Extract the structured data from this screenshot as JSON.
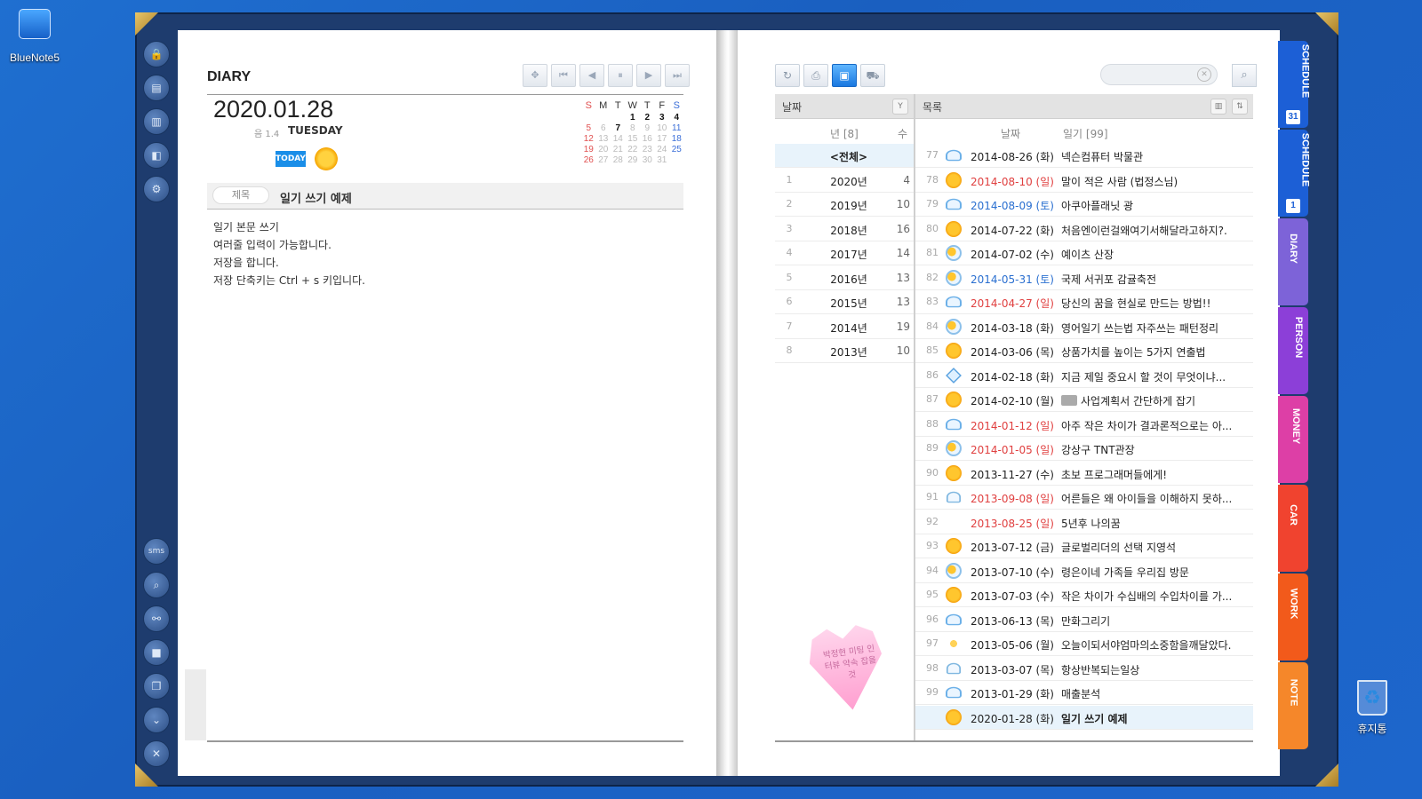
{
  "desktop": {
    "app_icon_label": "BlueNote5",
    "recycle_label": "휴지통"
  },
  "left_page": {
    "section_title": "DIARY",
    "date": "2020.01.28",
    "lunar": "음 1.4",
    "weekday": "TUESDAY",
    "today_label": "TODAY",
    "calendar": {
      "weekdays": [
        "S",
        "M",
        "T",
        "W",
        "T",
        "F",
        "S"
      ],
      "weeks": [
        [
          "",
          "",
          "",
          "1",
          "2",
          "3",
          "4"
        ],
        [
          "5",
          "6",
          "7",
          "8",
          "9",
          "10",
          "11"
        ],
        [
          "12",
          "13",
          "14",
          "15",
          "16",
          "17",
          "18"
        ],
        [
          "19",
          "20",
          "21",
          "22",
          "23",
          "24",
          "25"
        ],
        [
          "26",
          "27",
          "28",
          "29",
          "30",
          "31",
          ""
        ]
      ]
    },
    "subject_label": "제목",
    "subject_value": "일기 쓰기 예제",
    "body_lines": [
      "일기 본문 쓰기",
      "여러줄 입력이 가능합니다.",
      "저장을 합니다.",
      "저장 단축키는 Ctrl + s 키입니다."
    ]
  },
  "right_page": {
    "year_header": "날짜",
    "list_header": "목록",
    "year_col_label": "년 [8]",
    "count_col_label": "수",
    "date_col_label": "날짜",
    "diary_col_label": "일기 [99]",
    "search_value": "",
    "years": [
      {
        "n": "",
        "year": "<전체>",
        "count": ""
      },
      {
        "n": "1",
        "year": "2020년",
        "count": "4"
      },
      {
        "n": "2",
        "year": "2019년",
        "count": "10"
      },
      {
        "n": "3",
        "year": "2018년",
        "count": "16"
      },
      {
        "n": "4",
        "year": "2017년",
        "count": "14"
      },
      {
        "n": "5",
        "year": "2016년",
        "count": "13"
      },
      {
        "n": "6",
        "year": "2015년",
        "count": "13"
      },
      {
        "n": "7",
        "year": "2014년",
        "count": "19"
      },
      {
        "n": "8",
        "year": "2013년",
        "count": "10"
      }
    ],
    "entries": [
      {
        "n": "77",
        "weather": "cloud",
        "date": "2014-08-26 (화)",
        "color": "",
        "title": "넥슨컴퓨터 박물관"
      },
      {
        "n": "78",
        "weather": "sun",
        "date": "2014-08-10 (일)",
        "color": "red",
        "title": "말이 적은 사람 (법정스님)"
      },
      {
        "n": "79",
        "weather": "cloud",
        "date": "2014-08-09 (토)",
        "color": "blue",
        "title": "아쿠아플래닛 광"
      },
      {
        "n": "80",
        "weather": "sun",
        "date": "2014-07-22 (화)",
        "color": "",
        "title": "처음엔이런걸왜여기서해달라고하지?."
      },
      {
        "n": "81",
        "weather": "part",
        "date": "2014-07-02 (수)",
        "color": "",
        "title": "예이츠 산장"
      },
      {
        "n": "82",
        "weather": "part",
        "date": "2014-05-31 (토)",
        "color": "blue",
        "title": "국제 서귀포 감귤축전"
      },
      {
        "n": "83",
        "weather": "cloud",
        "date": "2014-04-27 (일)",
        "color": "red",
        "title": "당신의 꿈을 현실로 만드는 방법!!"
      },
      {
        "n": "84",
        "weather": "part",
        "date": "2014-03-18 (화)",
        "color": "",
        "title": "영어일기 쓰는법 자주쓰는 패턴정리"
      },
      {
        "n": "85",
        "weather": "sun",
        "date": "2014-03-06 (목)",
        "color": "",
        "title": "상품가치를 높이는 5가지 연출법"
      },
      {
        "n": "86",
        "weather": "diamond",
        "date": "2014-02-18 (화)",
        "color": "",
        "title": "지금 제일 중요시 할 것이 무엇이냐..."
      },
      {
        "n": "87",
        "weather": "sun",
        "date": "2014-02-10 (월)",
        "color": "",
        "title": "사업계획서 간단하게 잡기",
        "camera": true
      },
      {
        "n": "88",
        "weather": "cloud",
        "date": "2014-01-12 (일)",
        "color": "red",
        "title": "아주 작은 차이가 결과론적으로는 아..."
      },
      {
        "n": "89",
        "weather": "part",
        "date": "2014-01-05 (일)",
        "color": "red",
        "title": "강상구 TNT관장"
      },
      {
        "n": "90",
        "weather": "sun",
        "date": "2013-11-27 (수)",
        "color": "",
        "title": "초보 프로그래머들에게!"
      },
      {
        "n": "91",
        "weather": "rain",
        "date": "2013-09-08 (일)",
        "color": "red",
        "title": "어른들은 왜 아이들을 이해하지 못하..."
      },
      {
        "n": "92",
        "weather": "none",
        "date": "2013-08-25 (일)",
        "color": "red",
        "title": "5년후 나의꿈"
      },
      {
        "n": "93",
        "weather": "sun",
        "date": "2013-07-12 (금)",
        "color": "",
        "title": "글로벌리더의 선택 지영석"
      },
      {
        "n": "94",
        "weather": "part",
        "date": "2013-07-10 (수)",
        "color": "",
        "title": "령은이네 가족들 우리집 방문"
      },
      {
        "n": "95",
        "weather": "sun",
        "date": "2013-07-03 (수)",
        "color": "",
        "title": "작은 차이가 수십배의 수입차이를 가..."
      },
      {
        "n": "96",
        "weather": "cloud",
        "date": "2013-06-13 (목)",
        "color": "",
        "title": "만화그리기"
      },
      {
        "n": "97",
        "weather": "sunman",
        "date": "2013-05-06 (월)",
        "color": "",
        "title": "오늘이되서야엄마의소중함을깨달았다."
      },
      {
        "n": "98",
        "weather": "rain",
        "date": "2013-03-07 (목)",
        "color": "",
        "title": "항상반복되는일상"
      },
      {
        "n": "99",
        "weather": "cloud",
        "date": "2013-01-29 (화)",
        "color": "",
        "title": "매출분석"
      },
      {
        "n": "",
        "weather": "sun",
        "date": "2020-01-28 (화)",
        "color": "",
        "title": "일기 쓰기 예제",
        "selected": true
      }
    ],
    "sticky_note": "박정현 미팅 인터뷰 약속 잡을것"
  },
  "tabs": [
    {
      "label": "SCHEDULE",
      "badge": "31",
      "color": "#1c5fd6"
    },
    {
      "label": "SCHEDULE",
      "badge": "1",
      "color": "#1c5fd6"
    },
    {
      "label": "DIARY",
      "badge": "",
      "color": "#7d63d8"
    },
    {
      "label": "PERSON",
      "badge": "",
      "color": "#8c3fd8"
    },
    {
      "label": "MONEY",
      "badge": "",
      "color": "#dd3fa6"
    },
    {
      "label": "CAR",
      "badge": "",
      "color": "#f0432f"
    },
    {
      "label": "WORK",
      "badge": "",
      "color": "#f25a1b"
    },
    {
      "label": "NOTE",
      "badge": "",
      "color": "#f5872a"
    }
  ]
}
